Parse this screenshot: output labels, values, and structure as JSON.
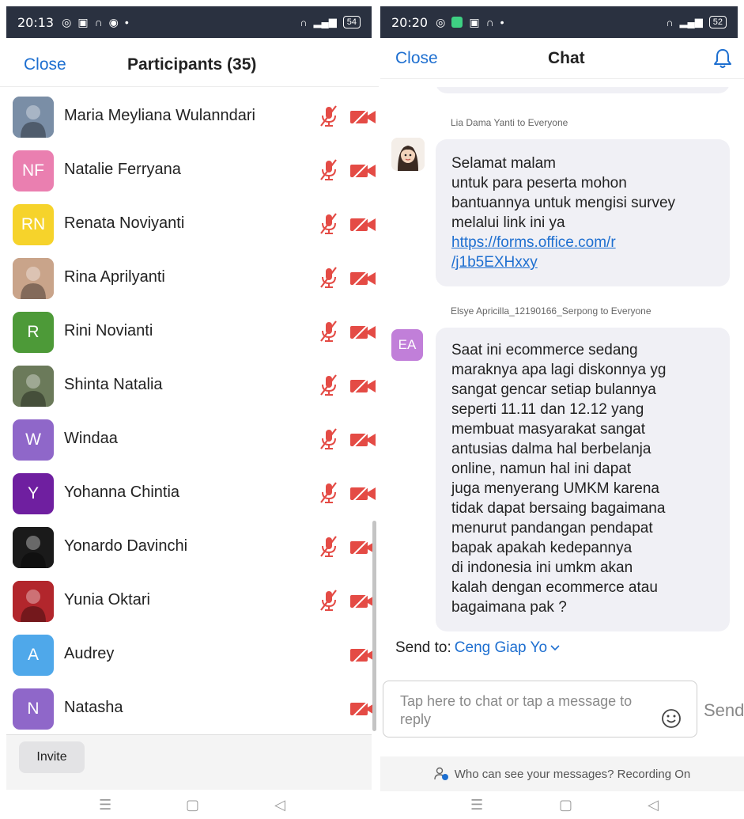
{
  "participants_screen": {
    "status": {
      "time": "20:13",
      "battery": "54"
    },
    "close_label": "Close",
    "title": "Participants (35)",
    "participants": [
      {
        "name": "Maria Meyliana Wulanndari",
        "initials": "",
        "color": "#7a8ea6",
        "muted": true,
        "video_off": true
      },
      {
        "name": "Natalie Ferryana",
        "initials": "NF",
        "color": "#ea7fb0",
        "muted": true,
        "video_off": true
      },
      {
        "name": "Renata Noviyanti",
        "initials": "RN",
        "color": "#f6d32b",
        "muted": true,
        "video_off": true
      },
      {
        "name": "Rina Aprilyanti",
        "initials": "",
        "color": "#c9a48a",
        "muted": true,
        "video_off": true
      },
      {
        "name": "Rini Novianti",
        "initials": "R",
        "color": "#4d9a38",
        "muted": true,
        "video_off": true
      },
      {
        "name": "Shinta Natalia",
        "initials": "",
        "color": "#6b7a5a",
        "muted": true,
        "video_off": true
      },
      {
        "name": "Windaa",
        "initials": "W",
        "color": "#8f67c9",
        "muted": true,
        "video_off": true
      },
      {
        "name": "Yohanna Chintia",
        "initials": "Y",
        "color": "#6f1fa0",
        "muted": true,
        "video_off": true
      },
      {
        "name": "Yonardo Davinchi",
        "initials": "",
        "color": "#1a1a1a",
        "muted": true,
        "video_off": true
      },
      {
        "name": "Yunia Oktari",
        "initials": "",
        "color": "#b2262c",
        "muted": true,
        "video_off": true
      },
      {
        "name": "Audrey",
        "initials": "A",
        "color": "#4fa8ea",
        "muted": false,
        "video_off": true
      },
      {
        "name": "Natasha",
        "initials": "N",
        "color": "#8f67c9",
        "muted": false,
        "video_off": true
      }
    ],
    "invite_label": "Invite"
  },
  "chat_screen": {
    "status": {
      "time": "20:20",
      "battery": "52"
    },
    "close_label": "Close",
    "title": "Chat",
    "messages": [
      {
        "sender": "Lia Dama Yanti to Everyone",
        "lines": [
          "Selamat malam",
          "untuk para peserta mohon",
          "bantuannya untuk mengisi survey",
          "melalui link ini ya"
        ],
        "link_lines": [
          "https://forms.office.com/r",
          "/j1b5EXHxxy"
        ]
      },
      {
        "sender": "Elsye Apricilla_12190166_Serpong to Everyone",
        "avatar_initials": "EA",
        "avatar_color": "#c17fd9",
        "lines": [
          "Saat ini ecommerce sedang",
          "maraknya apa lagi diskonnya yg",
          "sangat gencar setiap bulannya",
          "seperti 11.11 dan 12.12 yang",
          "membuat masyarakat sangat",
          "antusias dalma hal berbelanja",
          "online, namun hal ini dapat",
          "juga menyerang UMKM karena",
          "tidak dapat bersaing bagaimana",
          "menurut pandangan pendapat",
          "bapak apakah kedepannya",
          "di indonesia ini umkm akan",
          "kalah dengan ecommerce atau",
          "bagaimana pak ?"
        ]
      }
    ],
    "send_to_label": "Send to:",
    "send_to_target": "Ceng Giap Yo",
    "input_placeholder": "Tap here to chat or tap a message to reply",
    "send_label": "Send",
    "privacy_note": "Who can see your messages? Recording On"
  }
}
